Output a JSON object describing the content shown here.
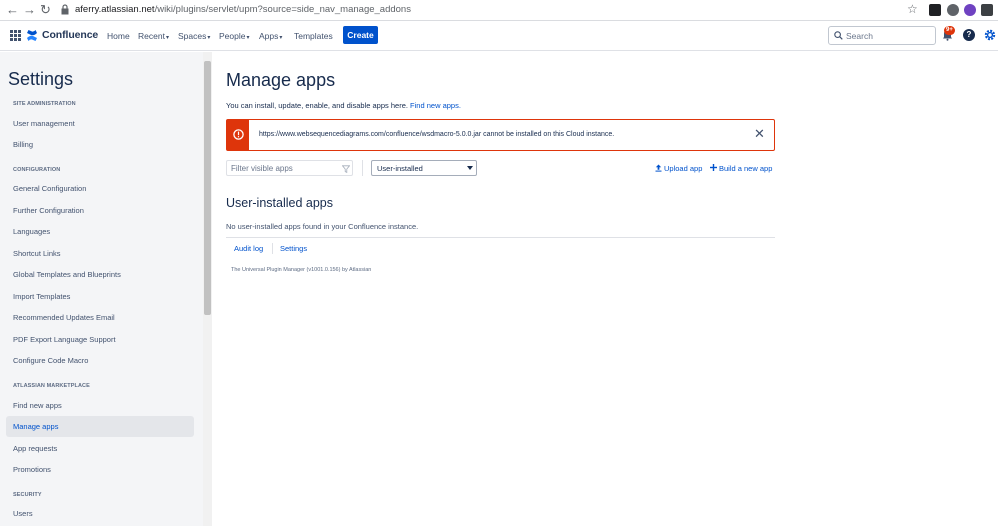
{
  "browser": {
    "back": "←",
    "forward": "→",
    "reload": "↻",
    "url_host": "aferry.atlassian.net",
    "url_path": "/wiki/plugins/servlet/upm?source=side_nav_manage_addons",
    "star": "☆"
  },
  "header": {
    "logo_text": "Confluence",
    "nav": [
      "Home",
      "Recent",
      "Spaces",
      "People",
      "Apps",
      "Templates"
    ],
    "create_label": "Create",
    "search_placeholder": "Search",
    "notif_badge": "9+",
    "help_label": "?"
  },
  "sidebar": {
    "title": "Settings",
    "sections": [
      {
        "heading": "SITE ADMINISTRATION",
        "items": [
          "User management",
          "Billing"
        ]
      },
      {
        "heading": "CONFIGURATION",
        "items": [
          "General Configuration",
          "Further Configuration",
          "Languages",
          "Shortcut Links",
          "Global Templates and Blueprints",
          "Import Templates",
          "Recommended Updates Email",
          "PDF Export Language Support",
          "Configure Code Macro"
        ]
      },
      {
        "heading": "ATLASSIAN MARKETPLACE",
        "items": [
          "Find new apps",
          "Manage apps",
          "App requests",
          "Promotions"
        ]
      },
      {
        "heading": "SECURITY",
        "items": [
          "Users"
        ]
      }
    ],
    "active_item": "Manage apps"
  },
  "main": {
    "title": "Manage apps",
    "intro": "You can install, update, enable, and disable apps here.",
    "intro_link": "Find new apps.",
    "error_message": "https://www.websequencediagrams.com/confluence/wsdmacro-5.0.0.jar cannot be installed on this Cloud instance.",
    "error_close": "✕",
    "filter_placeholder": "Filter visible apps",
    "select_value": "User-installed",
    "upload_label": "Upload app",
    "build_label": "Build a new app",
    "section_title": "User-installed apps",
    "no_apps_text": "No user-installed apps found in your Confluence instance.",
    "tabs": [
      "Audit log",
      "Settings"
    ],
    "footer_note": "The Universal Plugin Manager (v1001.0.156) by Atlassian"
  },
  "colors": {
    "brand": "#0052cc",
    "error": "#de350b",
    "text": "#172b4d"
  }
}
